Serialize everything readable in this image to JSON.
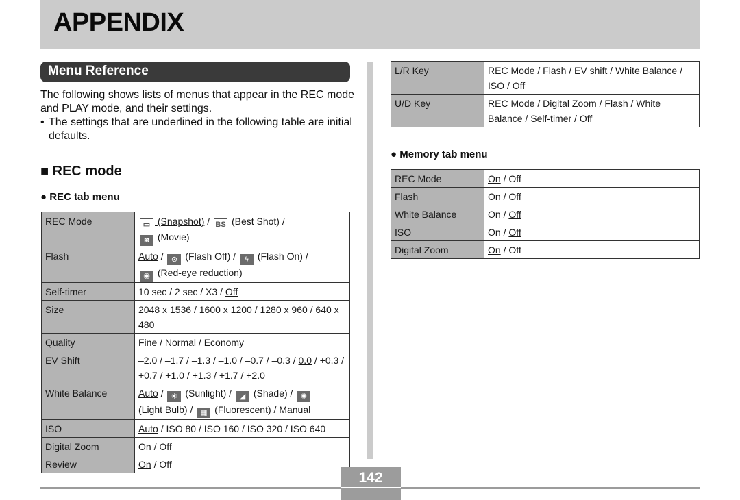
{
  "header": {
    "title": "APPENDIX"
  },
  "section": {
    "title": "Menu Reference"
  },
  "intro": {
    "paragraph": "The following shows lists of menus that appear in the REC mode and PLAY mode, and their settings.",
    "bullet_symbol": "•",
    "bullet": "The settings that are underlined in the following table are initial defaults."
  },
  "rec_mode": {
    "heading": "■ REC mode",
    "rec_tab": {
      "heading": "● REC tab menu",
      "rows": [
        {
          "key": "REC Mode",
          "icons": [
            "snapshot-icon",
            "best-shot-icon",
            "movie-icon"
          ],
          "value_parts": [
            "(Snapshot)",
            " / ",
            "(Best Shot) /",
            "(Movie)"
          ],
          "icon_glyphs": [
            "▭",
            "BS",
            "◙"
          ]
        },
        {
          "key": "Flash",
          "value_parts": [
            "Auto",
            " / ",
            "(Flash Off) / ",
            "(Flash On) /",
            "(Red-eye reduction)"
          ],
          "icon_glyphs": [
            "⊘",
            "ϟ",
            "◉"
          ]
        },
        {
          "key": "Self-timer",
          "value_parts": [
            "10 sec / 2 sec / X3 / ",
            "Off"
          ]
        },
        {
          "key": "Size",
          "value_parts": [
            "2048 x 1536",
            " / 1600 x 1200 / 1280 x 960 / 640 x 480"
          ]
        },
        {
          "key": "Quality",
          "value_parts": [
            "Fine / ",
            "Normal",
            " / Economy"
          ]
        },
        {
          "key": "EV Shift",
          "value_parts": [
            "–2.0 / –1.7 / –1.3 / –1.0 / –0.7 / –0.3 / ",
            "0.0",
            " / +0.3 / +0.7 / +1.0 / +1.3 / +1.7 / +2.0"
          ]
        },
        {
          "key": "White Balance",
          "value_parts": [
            "Auto",
            " / ",
            "(Sunlight) / ",
            "(Shade) / ",
            "(Light Bulb) / ",
            "(Fluorescent) / Manual"
          ],
          "icon_glyphs": [
            "☀",
            "◢",
            "✺",
            "▦"
          ]
        },
        {
          "key": "ISO",
          "value_parts": [
            "Auto",
            " / ISO 80 / ISO 160 / ISO 320 / ISO 640"
          ]
        },
        {
          "key": "Digital Zoom",
          "value_parts": [
            "On",
            " / Off"
          ]
        },
        {
          "key": "Review",
          "value_parts": [
            "On",
            " / Off"
          ]
        }
      ]
    }
  },
  "key_table": {
    "rows": [
      {
        "key": "L/R Key",
        "value_parts": [
          "REC Mode",
          " / Flash / EV shift / White Balance / ISO / Off"
        ]
      },
      {
        "key": "U/D Key",
        "value_parts": [
          "REC Mode / ",
          "Digital Zoom",
          " / Flash / White Balance / Self-timer / Off"
        ]
      }
    ]
  },
  "memory_tab": {
    "heading": "● Memory tab menu",
    "rows": [
      {
        "key": "REC Mode",
        "on": "On",
        "sep": " / ",
        "off": "Off",
        "default": "On"
      },
      {
        "key": "Flash",
        "on": "On",
        "sep": " / ",
        "off": "Off",
        "default": "On"
      },
      {
        "key": "White Balance",
        "on": "On",
        "sep": " / ",
        "off": "Off",
        "default": "Off"
      },
      {
        "key": "ISO",
        "on": "On",
        "sep": " / ",
        "off": "Off",
        "default": "Off"
      },
      {
        "key": "Digital Zoom",
        "on": "On",
        "sep": " / ",
        "off": "Off",
        "default": "On"
      }
    ]
  },
  "footer": {
    "page_number": "142"
  }
}
